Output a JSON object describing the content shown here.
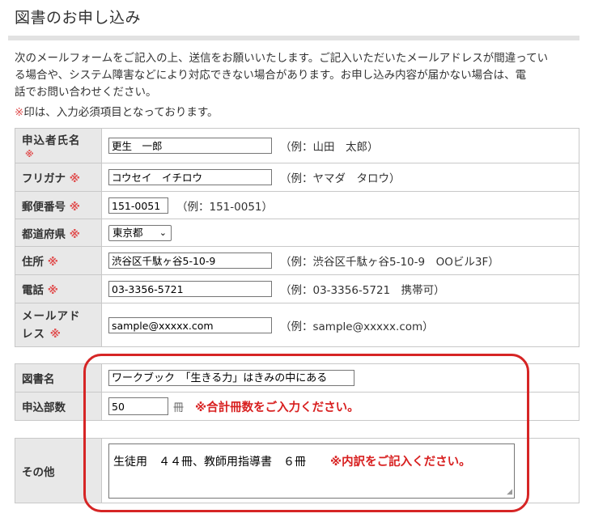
{
  "page": {
    "title": "図書のお申し込み",
    "intro_line1": "次のメールフォームをご記入の上、送信をお願いいたします。ご記入いただいたメールアドレスが間違ってい",
    "intro_line2": "る場合や、システム障害などにより対応できない場合があります。お申し込み内容が届かない場合は、電",
    "intro_line3": "話でお問い合わせください。",
    "req_mark": "※",
    "req_text": "印は、入力必須項目となっております。"
  },
  "form": {
    "required_mark": "※",
    "name": {
      "label": "申込者氏名",
      "value": "更生　一郎",
      "example": "（例：山田　太郎）"
    },
    "kana": {
      "label": "フリガナ",
      "value": "コウセイ　イチロウ",
      "example": "（例：ヤマダ　タロウ）"
    },
    "postal": {
      "label": "郵便番号",
      "value": "151-0051",
      "example": "（例：151-0051）"
    },
    "prefecture": {
      "label": "都道府県",
      "value": "東京都"
    },
    "address": {
      "label": "住所",
      "value": "渋谷区千駄ヶ谷5-10-9",
      "example": "（例：渋谷区千駄ヶ谷5-10-9　OOビル3F）"
    },
    "phone": {
      "label": "電話",
      "value": "03-3356-5721",
      "example": "（例：03-3356-5721　携帯可）"
    },
    "email": {
      "label_line1": "メールアド",
      "label_line2": "レス",
      "value": "sample@xxxxx.com",
      "example": "（例：sample@xxxxx.com）"
    }
  },
  "order": {
    "book": {
      "label": "図書名",
      "value": "ワークブック　「生きる力」はきみの中にある"
    },
    "quantity": {
      "label": "申込部数",
      "value": "50",
      "unit": "冊",
      "note": "※合計冊数をご入力ください。"
    },
    "other": {
      "label": "その他",
      "value": "生徒用　４４冊、教師用指導書　６冊",
      "note": "※内訳をご記入ください。"
    }
  },
  "colors": {
    "required": "#e05050",
    "highlight": "#d62525",
    "label_bg": "#e8e8e8"
  }
}
